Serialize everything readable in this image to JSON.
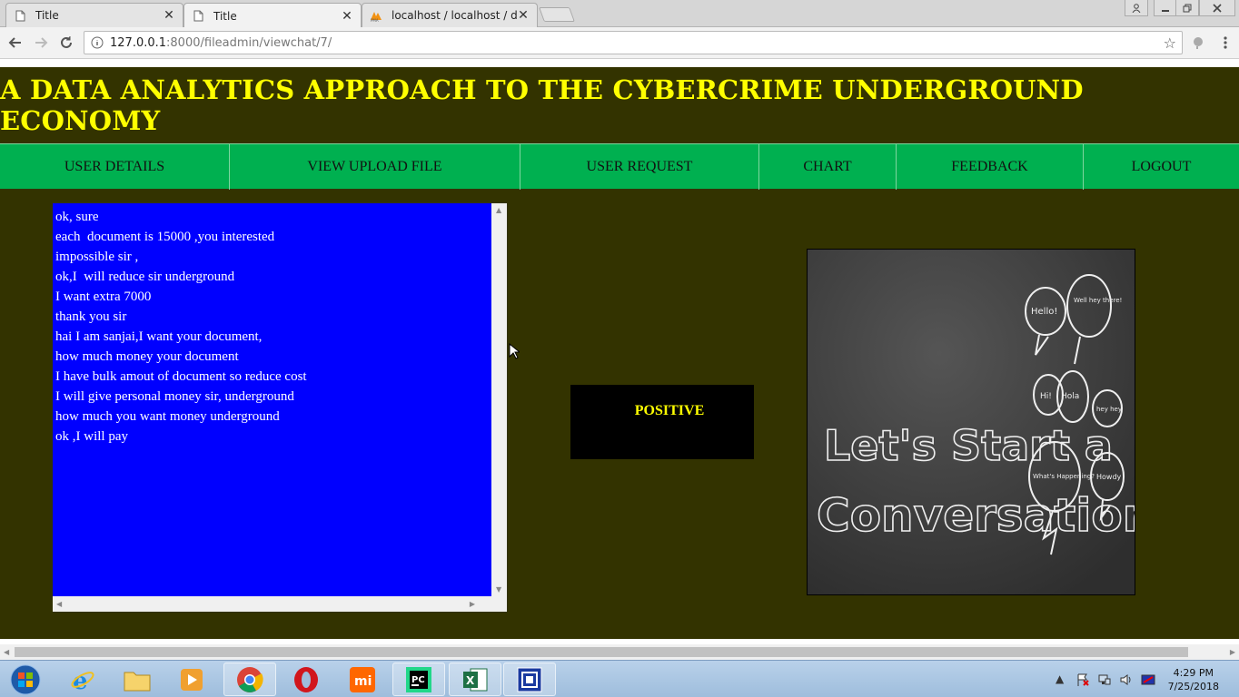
{
  "browser": {
    "tabs": [
      {
        "title": "Title",
        "icon": "page-icon"
      },
      {
        "title": "Title",
        "icon": "page-icon"
      },
      {
        "title": "localhost / localhost / da",
        "icon": "phpmyadmin-icon"
      }
    ],
    "address": {
      "host": "127.0.0.1",
      "path": ":8000/fileadmin/viewchat/7/"
    }
  },
  "header": {
    "title": "A DATA ANALYTICS APPROACH TO THE CYBERCRIME UNDERGROUND ECONOMY"
  },
  "menu": {
    "items": [
      "USER DETAILS",
      "VIEW UPLOAD FILE",
      "USER REQUEST",
      "CHART",
      "FEEDBACK",
      "LOGOUT"
    ]
  },
  "chat": {
    "lines": [
      "ok, sure",
      "each  document is 15000 ,you interested",
      "impossible sir ,",
      "ok,I  will reduce sir underground",
      "I want extra 7000",
      "thank you sir",
      "hai I am sanjai,I want your document,",
      "how much money your document",
      "I have bulk amout of document so reduce cost",
      "I will give personal money sir, underground",
      "how much you want money underground",
      "ok ,I will pay"
    ]
  },
  "sentiment": {
    "label": "POSITIVE"
  },
  "image": {
    "caption_line1": "Let's Start a",
    "caption_line2": "Conversation",
    "bubbles": [
      "Hello!",
      "Well hey there!",
      "Hi!",
      "Hola",
      "hey hey",
      "What's Happening?",
      "Howdy"
    ]
  },
  "taskbar": {
    "apps": [
      "start-orb-icon",
      "internet-explorer-icon",
      "file-explorer-icon",
      "media-player-icon",
      "chrome-icon",
      "opera-icon",
      "mi-icon",
      "pycharm-icon",
      "excel-icon",
      "remote-desktop-icon"
    ],
    "time": "4:29 PM",
    "date": "7/25/2018"
  },
  "colors": {
    "page_bg": "#333300",
    "title": "#ffff00",
    "menu_bg": "#00b050",
    "chat_bg": "#0000ff",
    "sentiment_bg": "#000000"
  }
}
